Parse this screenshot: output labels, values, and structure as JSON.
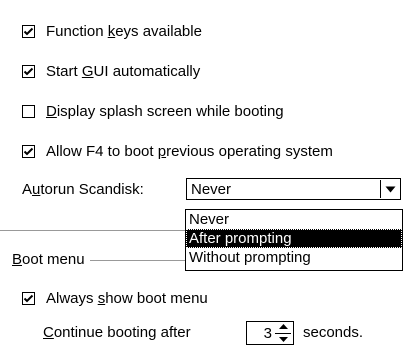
{
  "checkboxes": [
    {
      "label_pre": "Function ",
      "accel": "k",
      "label_post": "eys available",
      "checked": true
    },
    {
      "label_pre": "Start ",
      "accel": "G",
      "label_post": "UI automatically",
      "checked": true
    },
    {
      "label_pre": "",
      "accel": "D",
      "label_post": "isplay splash screen while booting",
      "checked": false
    },
    {
      "label_pre": "Allow F4 to boot ",
      "accel": "p",
      "label_post": "revious operating system",
      "checked": true
    }
  ],
  "autorun": {
    "label_pre": "A",
    "accel": "u",
    "label_post": "torun Scandisk:",
    "selected": "Never",
    "options": [
      "Never",
      "After prompting",
      "Without prompting"
    ],
    "highlighted_option": "After prompting"
  },
  "boot_menu": {
    "group_pre": "",
    "group_accel": "B",
    "group_post": "oot menu",
    "always_show": {
      "label_pre": "Always ",
      "accel": "s",
      "label_post": "how boot menu",
      "checked": true
    },
    "continue": {
      "label_pre": "",
      "accel": "C",
      "label_post": "ontinue booting after",
      "value": "3",
      "suffix": "seconds."
    }
  }
}
